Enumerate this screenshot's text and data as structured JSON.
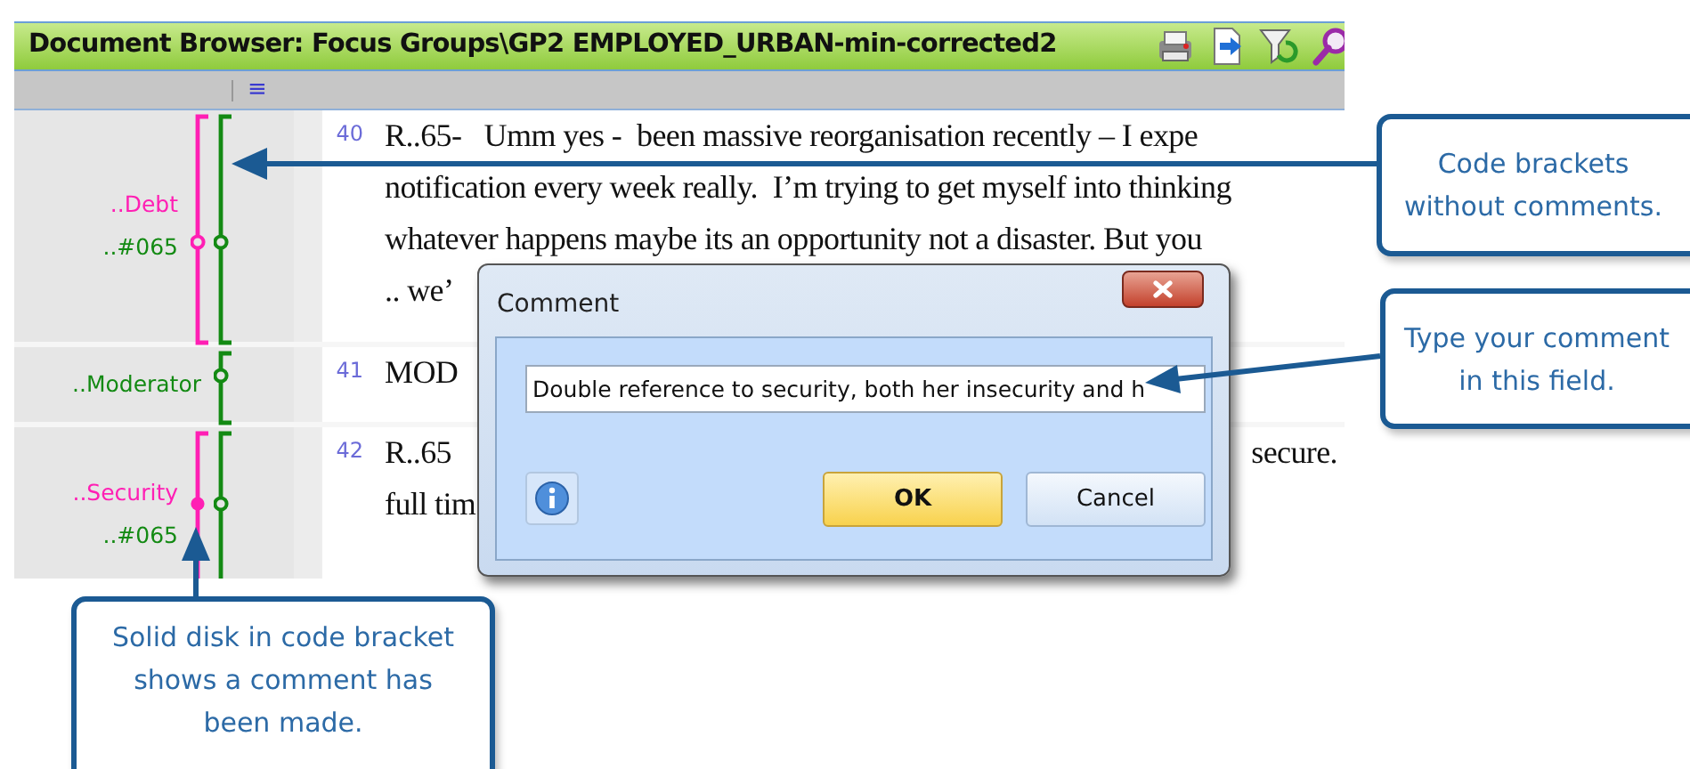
{
  "window": {
    "title": "Document Browser: Focus Groups\\GP2 EMPLOYED_URBAN-min-corrected2"
  },
  "toolbar": {
    "menu_glyph": "≡"
  },
  "rows": [
    {
      "number": "40",
      "lines": [
        {
          "text": "R..65-   Umm yes -  been massive reorganisation recently – I expe"
        },
        {
          "text": "notification every week really.  I’m trying to get myself into thinking"
        },
        {
          "text": "whatever happens maybe its an opportunity not a disaster. But you"
        },
        {
          "text": ".. we’"
        }
      ],
      "codes": [
        {
          "label": "..Debt",
          "color": "#ff1fb4",
          "commented": false
        },
        {
          "label": "..#065",
          "color": "#138a13",
          "commented": false
        }
      ]
    },
    {
      "number": "41",
      "lines": [
        {
          "text": "MOD"
        }
      ],
      "codes": [
        {
          "label": "..Moderator",
          "color": "#138a13",
          "commented": false
        }
      ]
    },
    {
      "number": "42",
      "lines": [
        {
          "text": "R..65",
          "tail": "secure."
        },
        {
          "text": "full tim"
        }
      ],
      "codes": [
        {
          "label": "..Security",
          "color": "#ff1fb4",
          "commented": true
        },
        {
          "label": "..#065",
          "color": "#138a13",
          "commented": false
        }
      ]
    }
  ],
  "dialog": {
    "title": "Comment",
    "value": "Double reference to security, both her insecurity and h",
    "buttons": [
      "OK",
      "Cancel"
    ]
  },
  "callouts": [
    {
      "lines": [
        "Code brackets",
        "without comments."
      ]
    },
    {
      "lines": [
        "Type your comment",
        "in this field."
      ]
    },
    {
      "lines": [
        "Solid disk in code bracket",
        "shows a comment has",
        "been made."
      ]
    }
  ]
}
